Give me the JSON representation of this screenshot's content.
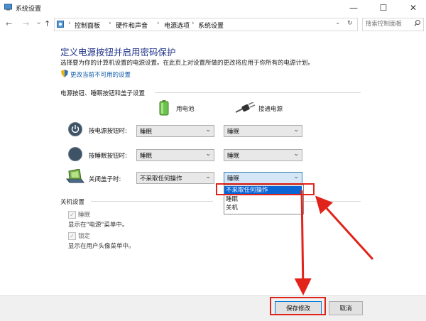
{
  "window": {
    "title": "系统设置",
    "controls": [
      "—",
      "☐",
      "✕"
    ]
  },
  "nav": {
    "back": "←",
    "forward": "→",
    "dropdown": "⌄",
    "up": "↑",
    "refresh": "↻",
    "breadcrumbs": [
      "控制面板",
      "硬件和声音",
      "电源选项",
      "系统设置"
    ],
    "search_placeholder": "搜索控制面板"
  },
  "page": {
    "title": "定义电源按钮并启用密码保护",
    "description": "选择要为你的计算机设置的电源设置。在此页上对设置所做的更改将应用于你所有的电源计划。",
    "change_link": "更改当前不可用的设置",
    "section_power": "电源按钮、睡眠按钮和盖子设置",
    "col_battery": "用电池",
    "col_plugged": "接通电源",
    "rows": [
      {
        "label": "按电源按钮时:",
        "battery": "睡眠",
        "plugged": "睡眠"
      },
      {
        "label": "按睡眠按钮时:",
        "battery": "睡眠",
        "plugged": "睡眠"
      },
      {
        "label": "关闭盖子时:",
        "battery": "不采取任何操作",
        "plugged": "睡眠"
      }
    ],
    "dropdown_options": [
      "不采取任何操作",
      "睡眠",
      "关机"
    ],
    "dropdown_selected_index": 0,
    "section_shutdown": "关机设置",
    "shutdown_items": [
      {
        "label": "睡眠",
        "desc": "显示在\"电源\"菜单中。",
        "checked": true
      },
      {
        "label": "锁定",
        "desc": "显示在用户头像菜单中。",
        "checked": true
      }
    ]
  },
  "buttons": {
    "save": "保存修改",
    "cancel": "取消"
  },
  "annotation_color": "#e2231a",
  "accent_color": "#1e3287"
}
